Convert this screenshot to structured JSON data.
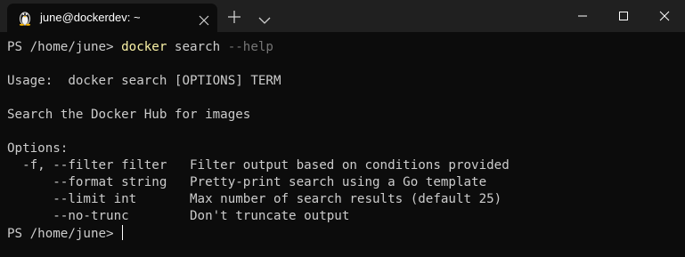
{
  "tab": {
    "title": "june@dockerdev: ~",
    "icon": "linux-penguin-icon"
  },
  "titlebar": {
    "new_tab_icon": "plus-icon",
    "dropdown_icon": "chevron-down-icon",
    "minimize_icon": "minimize-icon",
    "maximize_icon": "maximize-icon",
    "close_icon": "close-icon"
  },
  "terminal": {
    "prompt1": "PS /home/june> ",
    "command": "docker",
    "command_args": " search ",
    "command_flag": "--help",
    "usage": "Usage:  docker search [OPTIONS] TERM",
    "description": "Search the Docker Hub for images",
    "options_header": "Options:",
    "options": [
      "  -f, --filter filter   Filter output based on conditions provided",
      "      --format string   Pretty-print search using a Go template",
      "      --limit int       Max number of search results (default 25)",
      "      --no-trunc        Don't truncate output"
    ],
    "prompt2": "PS /home/june> "
  },
  "colors": {
    "background": "#0c0c0c",
    "titlebar": "#202020",
    "text": "#cccccc",
    "command": "#f9f1a5",
    "flag": "#767676"
  }
}
